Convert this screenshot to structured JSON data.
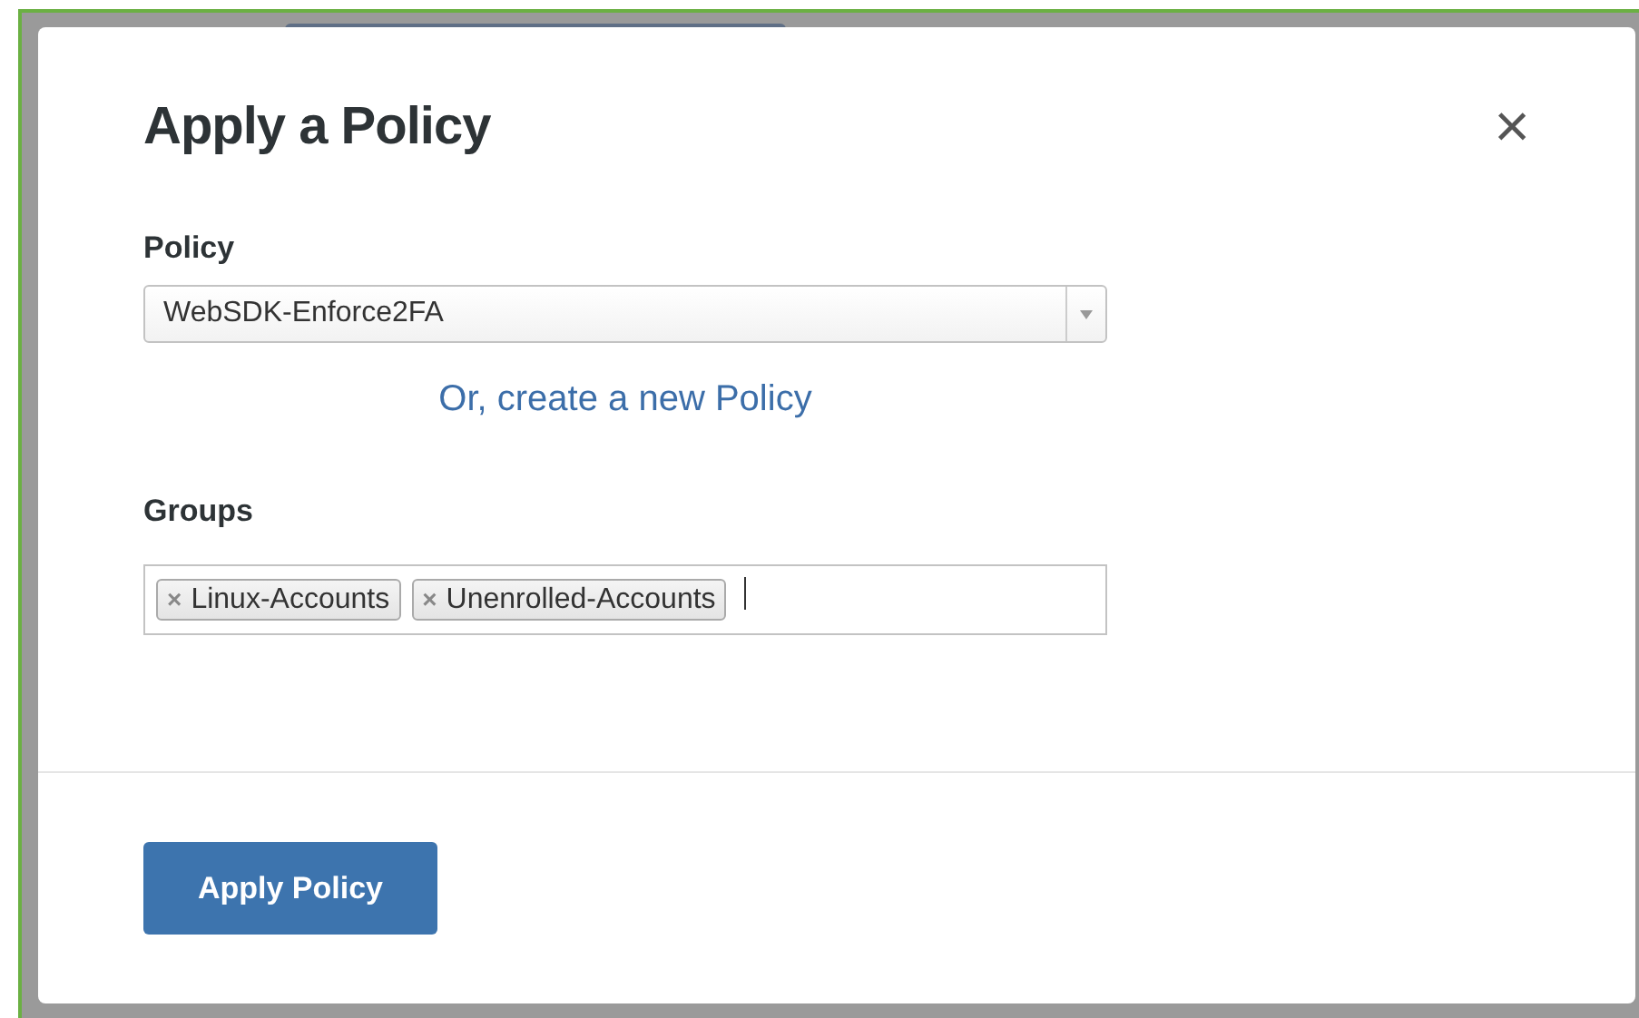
{
  "dialog": {
    "title": "Apply a Policy",
    "close": "×"
  },
  "policy": {
    "label": "Policy",
    "value": "WebSDK-Enforce2FA"
  },
  "create_link": "Or, create a new Policy",
  "groups": {
    "label": "Groups",
    "tags": [
      {
        "label": "Linux-Accounts",
        "remove": "×"
      },
      {
        "label": "Unenrolled-Accounts",
        "remove": "×"
      }
    ]
  },
  "submit": "Apply Policy"
}
